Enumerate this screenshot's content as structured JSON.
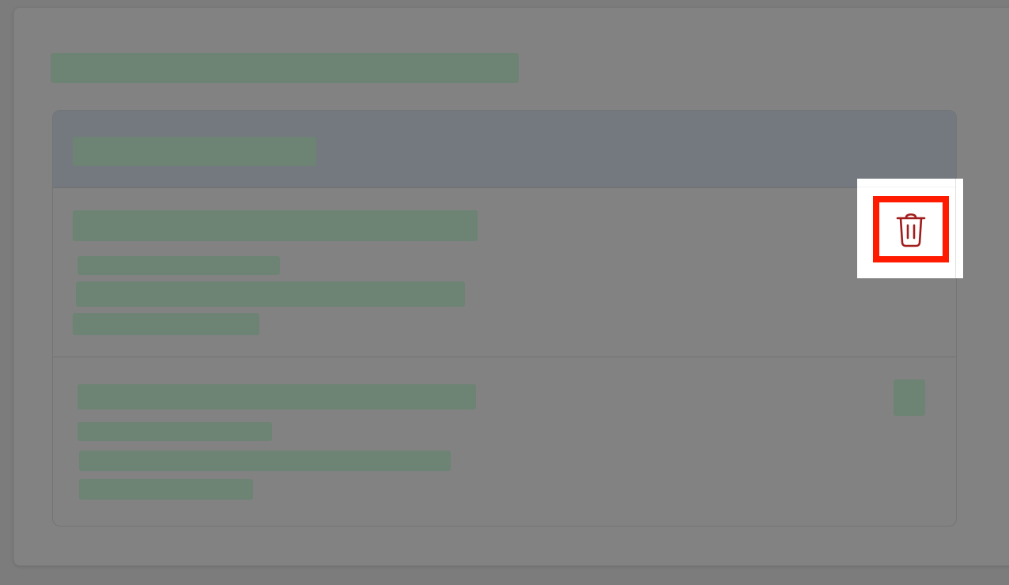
{
  "colors": {
    "overlay": "#828282",
    "redaction": "#6d8374",
    "highlight": "#ff1a00",
    "delete_icon": "#a11c1c"
  },
  "icons": {
    "delete": "trash-icon"
  }
}
